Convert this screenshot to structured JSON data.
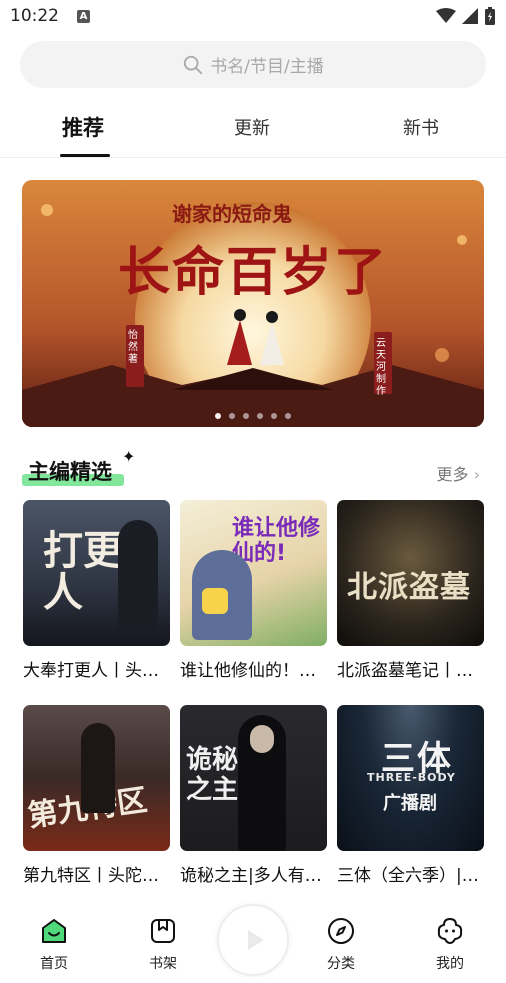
{
  "status_bar": {
    "time": "10:22",
    "notif_glyph": "A"
  },
  "search": {
    "placeholder": "书名/节目/主播",
    "icon": "search-icon"
  },
  "tabs": [
    {
      "label": "推荐",
      "active": true
    },
    {
      "label": "更新",
      "active": false
    },
    {
      "label": "新书",
      "active": false
    }
  ],
  "banner": {
    "top_text": "谢家的短命鬼",
    "main_text": "长命百岁了",
    "author_tag": "怡然 著",
    "producer_tag": "云天河 制作",
    "dots": 6
  },
  "section": {
    "title": "主编精选",
    "more": "更多"
  },
  "books": [
    {
      "title": "大奉打更人丨头陀渊演播",
      "cover_text": "打更人",
      "cover_bg": "#2e3442"
    },
    {
      "title": "谁让他修仙的！丨有声剧",
      "cover_text": "谁让他修仙的!",
      "cover_bg": "#e8e0c8"
    },
    {
      "title": "北派盗墓笔记丨云峰",
      "cover_text": "北派盗墓",
      "cover_bg": "#1d1a17"
    },
    {
      "title": "第九特区丨头陀渊演播",
      "cover_text": "第九特区",
      "cover_bg": "#3a2a27"
    },
    {
      "title": "诡秘之主|多人有声剧",
      "cover_text": "诡秘之主",
      "cover_bg": "#1c1c1f"
    },
    {
      "title": "三体（全六季）|广播剧",
      "cover_text": "三体",
      "cover_bg": "#0f1a26",
      "cover_sub": "THREE-BODY",
      "cover_sub2": "广播剧"
    }
  ],
  "bottom_nav": [
    {
      "label": "首页",
      "icon": "home-icon",
      "active": true
    },
    {
      "label": "书架",
      "icon": "bookshelf-icon",
      "active": false
    },
    {
      "label": "分类",
      "icon": "compass-icon",
      "active": false
    },
    {
      "label": "我的",
      "icon": "profile-icon",
      "active": false
    }
  ],
  "colors": {
    "accent": "#4fd97a",
    "search_bg": "#f3f3f3",
    "text": "#1a1a1a",
    "muted": "#a8a8a8"
  }
}
